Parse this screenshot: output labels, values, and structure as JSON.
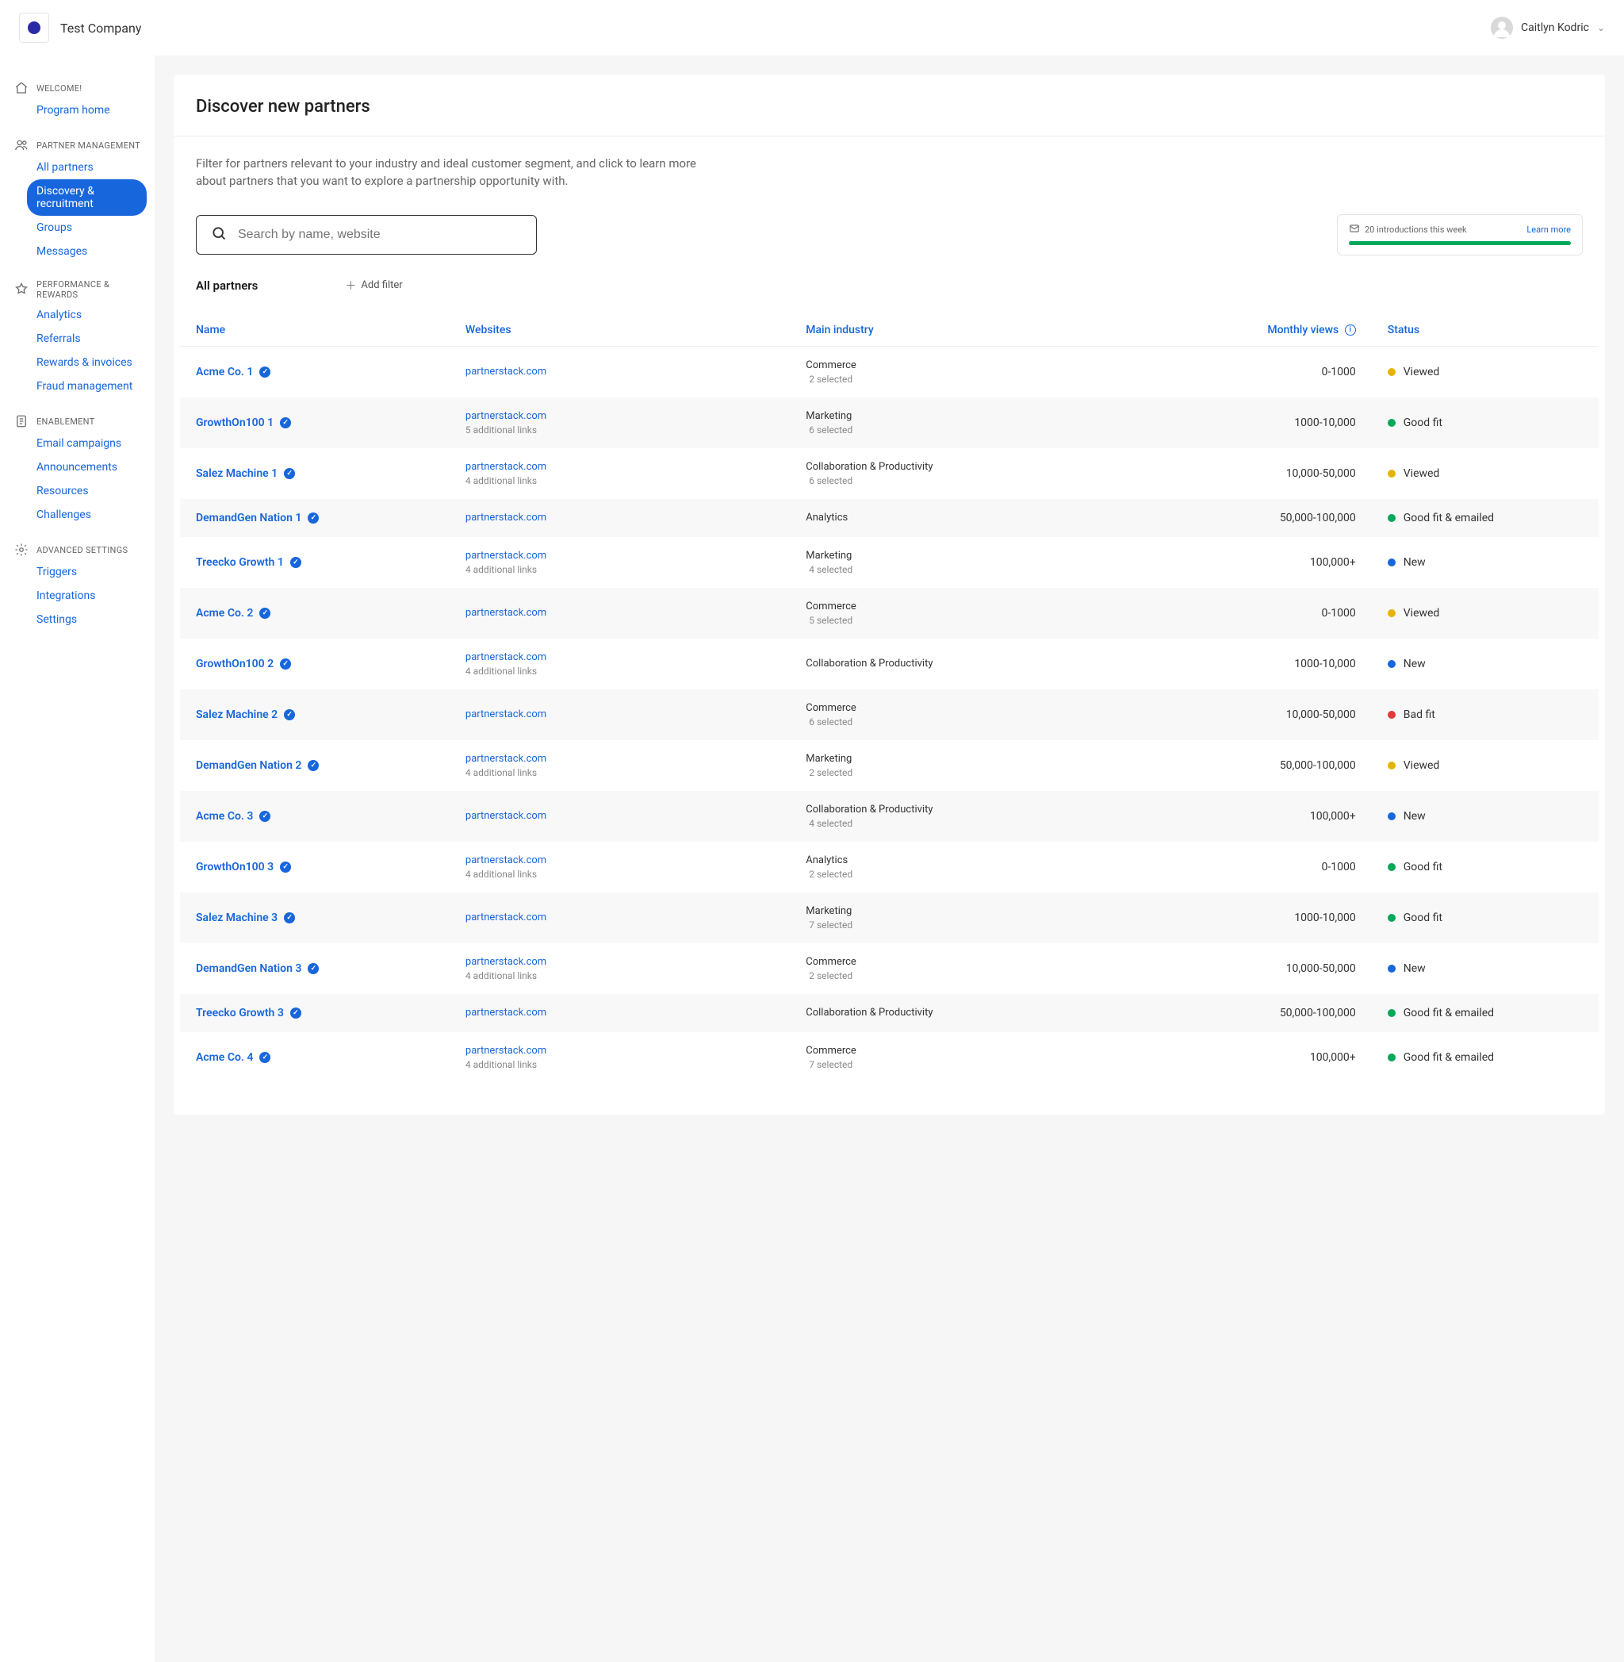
{
  "header": {
    "company": "Test Company",
    "user": "Caitlyn Kodric"
  },
  "sidebar": {
    "sections": [
      {
        "title": "WELCOME!",
        "items": [
          {
            "label": "Program home",
            "active": false
          }
        ]
      },
      {
        "title": "PARTNER MANAGEMENT",
        "items": [
          {
            "label": "All partners",
            "active": false
          },
          {
            "label": "Discovery & recruitment",
            "active": true
          },
          {
            "label": "Groups",
            "active": false
          },
          {
            "label": "Messages",
            "active": false
          }
        ]
      },
      {
        "title": "PERFORMANCE & REWARDS",
        "items": [
          {
            "label": "Analytics",
            "active": false
          },
          {
            "label": "Referrals",
            "active": false
          },
          {
            "label": "Rewards & invoices",
            "active": false
          },
          {
            "label": "Fraud management",
            "active": false
          }
        ]
      },
      {
        "title": "ENABLEMENT",
        "items": [
          {
            "label": "Email campaigns",
            "active": false
          },
          {
            "label": "Announcements",
            "active": false
          },
          {
            "label": "Resources",
            "active": false
          },
          {
            "label": "Challenges",
            "active": false
          }
        ]
      },
      {
        "title": "ADVANCED SETTINGS",
        "items": [
          {
            "label": "Triggers",
            "active": false
          },
          {
            "label": "Integrations",
            "active": false
          },
          {
            "label": "Settings",
            "active": false
          }
        ]
      }
    ]
  },
  "page": {
    "title": "Discover new partners",
    "subtitle": "Filter for partners relevant to your industry and ideal customer segment, and click to learn more about partners that you want to explore a partnership opportunity with.",
    "search_placeholder": "Search by name, website",
    "intro_text": "20 introductions this week",
    "intro_link": "Learn more",
    "filter_title": "All partners",
    "add_filter": "Add filter"
  },
  "table": {
    "columns": {
      "name": "Name",
      "websites": "Websites",
      "industry": "Main industry",
      "views": "Monthly views",
      "status": "Status"
    },
    "rows": [
      {
        "name": "Acme Co. 1",
        "website": "partnerstack.com",
        "extra_links": "",
        "industry": "Commerce",
        "industry_sub": "2 selected",
        "views": "0-1000",
        "status": "Viewed",
        "status_color": "yellow"
      },
      {
        "name": "GrowthOn100 1",
        "website": "partnerstack.com",
        "extra_links": "5 additional links",
        "industry": "Marketing",
        "industry_sub": "6 selected",
        "views": "1000-10,000",
        "status": "Good fit",
        "status_color": "green"
      },
      {
        "name": "Salez Machine 1",
        "website": "partnerstack.com",
        "extra_links": "4 additional links",
        "industry": "Collaboration & Productivity",
        "industry_sub": "6 selected",
        "views": "10,000-50,000",
        "status": "Viewed",
        "status_color": "yellow"
      },
      {
        "name": "DemandGen Nation 1",
        "website": "partnerstack.com",
        "extra_links": "",
        "industry": "Analytics",
        "industry_sub": "",
        "views": "50,000-100,000",
        "status": "Good fit & emailed",
        "status_color": "green"
      },
      {
        "name": "Treecko Growth 1",
        "website": "partnerstack.com",
        "extra_links": "4 additional links",
        "industry": "Marketing",
        "industry_sub": "4 selected",
        "views": "100,000+",
        "status": "New",
        "status_color": "blue"
      },
      {
        "name": "Acme Co. 2",
        "website": "partnerstack.com",
        "extra_links": "",
        "industry": "Commerce",
        "industry_sub": "5 selected",
        "views": "0-1000",
        "status": "Viewed",
        "status_color": "yellow"
      },
      {
        "name": "GrowthOn100 2",
        "website": "partnerstack.com",
        "extra_links": "4 additional links",
        "industry": "Collaboration & Productivity",
        "industry_sub": "",
        "views": "1000-10,000",
        "status": "New",
        "status_color": "blue"
      },
      {
        "name": "Salez Machine 2",
        "website": "partnerstack.com",
        "extra_links": "",
        "industry": "Commerce",
        "industry_sub": "6 selected",
        "views": "10,000-50,000",
        "status": "Bad fit",
        "status_color": "red"
      },
      {
        "name": "DemandGen Nation 2",
        "website": "partnerstack.com",
        "extra_links": "4 additional links",
        "industry": "Marketing",
        "industry_sub": "2 selected",
        "views": "50,000-100,000",
        "status": "Viewed",
        "status_color": "yellow"
      },
      {
        "name": "Acme Co. 3",
        "website": "partnerstack.com",
        "extra_links": "",
        "industry": "Collaboration & Productivity",
        "industry_sub": "4 selected",
        "views": "100,000+",
        "status": "New",
        "status_color": "blue"
      },
      {
        "name": "GrowthOn100 3",
        "website": "partnerstack.com",
        "extra_links": "4 additional links",
        "industry": "Analytics",
        "industry_sub": "2 selected",
        "views": "0-1000",
        "status": "Good fit",
        "status_color": "green"
      },
      {
        "name": "Salez Machine 3",
        "website": "partnerstack.com",
        "extra_links": "",
        "industry": "Marketing",
        "industry_sub": "7 selected",
        "views": "1000-10,000",
        "status": "Good fit",
        "status_color": "green"
      },
      {
        "name": "DemandGen Nation 3",
        "website": "partnerstack.com",
        "extra_links": "4 additional links",
        "industry": "Commerce",
        "industry_sub": "2 selected",
        "views": "10,000-50,000",
        "status": "New",
        "status_color": "blue"
      },
      {
        "name": "Treecko Growth 3",
        "website": "partnerstack.com",
        "extra_links": "",
        "industry": "Collaboration & Productivity",
        "industry_sub": "",
        "views": "50,000-100,000",
        "status": "Good fit & emailed",
        "status_color": "green"
      },
      {
        "name": "Acme Co. 4",
        "website": "partnerstack.com",
        "extra_links": "4 additional links",
        "industry": "Commerce",
        "industry_sub": "7 selected",
        "views": "100,000+",
        "status": "Good fit & emailed",
        "status_color": "green"
      }
    ]
  }
}
